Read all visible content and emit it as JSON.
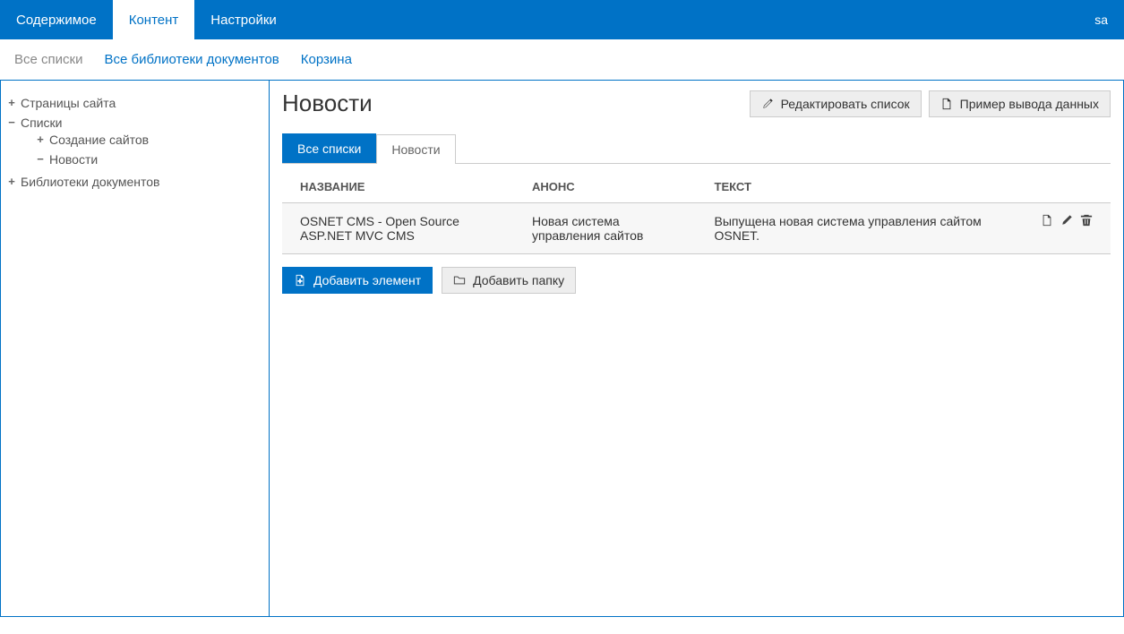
{
  "topbar": {
    "tabs": [
      {
        "label": "Содержимое",
        "active": false
      },
      {
        "label": "Контент",
        "active": true
      },
      {
        "label": "Настройки",
        "active": false
      }
    ],
    "user": "sa"
  },
  "subnav": {
    "items": [
      {
        "label": "Все списки",
        "muted": true
      },
      {
        "label": "Все библиотеки документов",
        "muted": false
      },
      {
        "label": "Корзина",
        "muted": false
      }
    ]
  },
  "tree": {
    "items": [
      {
        "label": "Страницы сайта",
        "expand": "+"
      },
      {
        "label": "Списки",
        "expand": "−",
        "children": [
          {
            "label": "Создание сайтов",
            "expand": "+"
          },
          {
            "label": "Новости",
            "expand": "−"
          }
        ]
      },
      {
        "label": "Библиотеки документов",
        "expand": "+"
      }
    ]
  },
  "page": {
    "title": "Новости",
    "edit_list": "Редактировать список",
    "example_output": "Пример вывода данных"
  },
  "content_tabs": {
    "all_lists": "Все списки",
    "news": "Новости"
  },
  "table": {
    "headers": {
      "name": "НАЗВАНИЕ",
      "anons": "АНОНС",
      "text": "ТЕКСТ"
    },
    "rows": [
      {
        "name": "OSNET CMS - Open Source ASP.NET MVC CMS",
        "anons": "Новая система управления сайтов",
        "text": "Выпущена новая система управления сайтом OSNET."
      }
    ]
  },
  "actions": {
    "add_element": "Добавить элемент",
    "add_folder": "Добавить папку"
  }
}
